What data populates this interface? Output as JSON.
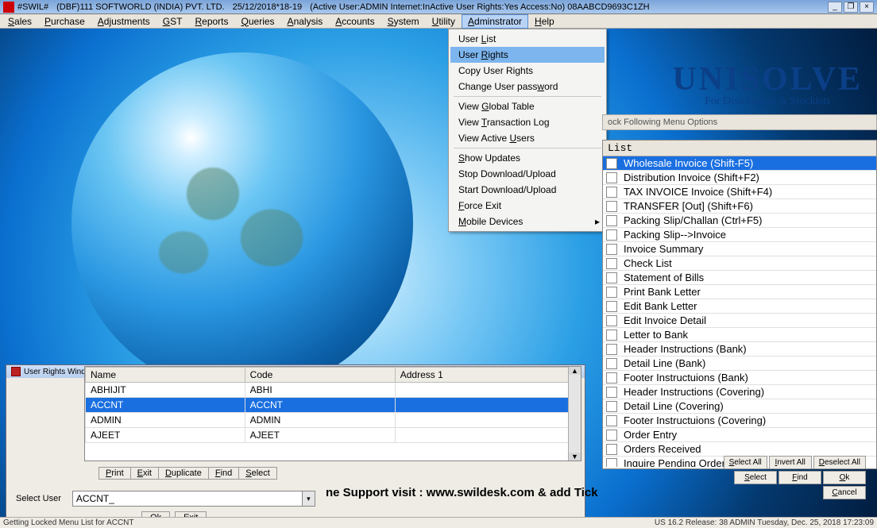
{
  "title": {
    "app": "#SWIL#",
    "company": "(DBF)111 SOFTWORLD (INDIA) PVT. LTD.",
    "date": "25/12/2018*18-19",
    "info": "(Active User:ADMIN Internet:InActive User Rights:Yes Access:No) 08AABCD9693C1ZH"
  },
  "winbtns": {
    "min": "_",
    "max": "❐",
    "close": "×"
  },
  "menubar": [
    "Sales",
    "Purchase",
    "Adjustments",
    "GST",
    "Reports",
    "Queries",
    "Analysis",
    "Accounts",
    "System",
    "Utility",
    "Adminstrator",
    "Help"
  ],
  "dropdown": [
    {
      "t": "User List",
      "u": "L"
    },
    {
      "t": "User Rights",
      "u": "R",
      "sel": true
    },
    {
      "t": "Copy User Rights"
    },
    {
      "t": "Change User password",
      "u": "w"
    },
    {
      "sep": true
    },
    {
      "t": "View Global Table",
      "u": "G"
    },
    {
      "t": "View Transaction Log",
      "u": "T"
    },
    {
      "t": "View Active Users",
      "u": "U"
    },
    {
      "sep": true
    },
    {
      "t": "Show Updates",
      "u": "S"
    },
    {
      "t": "Stop Download/Upload"
    },
    {
      "t": "Start Download/Upload"
    },
    {
      "t": "Force Exit",
      "u": "F"
    },
    {
      "t": "Mobile Devices",
      "u": "M",
      "arrow": true
    }
  ],
  "brand": {
    "u": "UNISOLVE",
    "s": "For Distributors & Stockists"
  },
  "lockhdr": "ock Following Menu Options",
  "list": {
    "hdr": "List",
    "items": [
      {
        "t": "Wholesale Invoice (Shift-F5)",
        "sel": true
      },
      {
        "t": "Distribution Invoice (Shift+F2)"
      },
      {
        "t": "TAX INVOICE Invoice   (Shift+F4)"
      },
      {
        "t": "TRANSFER [Out]  (Shift+F6)"
      },
      {
        "t": "Packing Slip/Challan (Ctrl+F5)"
      },
      {
        "t": "Packing Slip-->Invoice"
      },
      {
        "t": "Invoice Summary"
      },
      {
        "t": "Check List"
      },
      {
        "t": "Statement of Bills"
      },
      {
        "t": "Print Bank Letter"
      },
      {
        "t": "Edit Bank Letter"
      },
      {
        "t": "Edit Invoice Detail"
      },
      {
        "t": "Letter to Bank"
      },
      {
        "t": "Header Instructions (Bank)"
      },
      {
        "t": "Detail Line (Bank)"
      },
      {
        "t": "Footer Instructuions (Bank)"
      },
      {
        "t": "Header Instructions (Covering)"
      },
      {
        "t": "Detail Line (Covering)"
      },
      {
        "t": "Footer Instructuions (Covering)"
      },
      {
        "t": "Order Entry"
      },
      {
        "t": "Orders Received"
      },
      {
        "t": "Inquire Pending Orders"
      }
    ]
  },
  "lockbtns": [
    "Select All",
    "Invert All",
    "Deselect All",
    "Select",
    "Find",
    "Ok",
    "Cancel"
  ],
  "ur": {
    "title": "User Rights Window",
    "cols": [
      "Name",
      "Code",
      "Address 1"
    ],
    "rows": [
      {
        "c": [
          "ABHIJIT",
          "ABHI",
          ""
        ]
      },
      {
        "c": [
          "ACCNT",
          "ACCNT",
          ""
        ],
        "sel": true
      },
      {
        "c": [
          "ADMIN",
          "ADMIN",
          ""
        ]
      },
      {
        "c": [
          "AJEET",
          "AJEET",
          ""
        ]
      }
    ],
    "btns": [
      "Print",
      "Exit",
      "Duplicate",
      "Find",
      "Select"
    ],
    "sel_label": "Select User",
    "sel_value": "ACCNT_",
    "ok": "Ok",
    "exit": "Exit"
  },
  "support": "ne Support visit : www.swildesk.com & add Tick",
  "status": {
    "left": "Getting Locked Menu List for ACCNT",
    "right": "US 16.2 Release: 38  ADMIN  Tuesday, Dec. 25, 2018  17:23:09"
  }
}
